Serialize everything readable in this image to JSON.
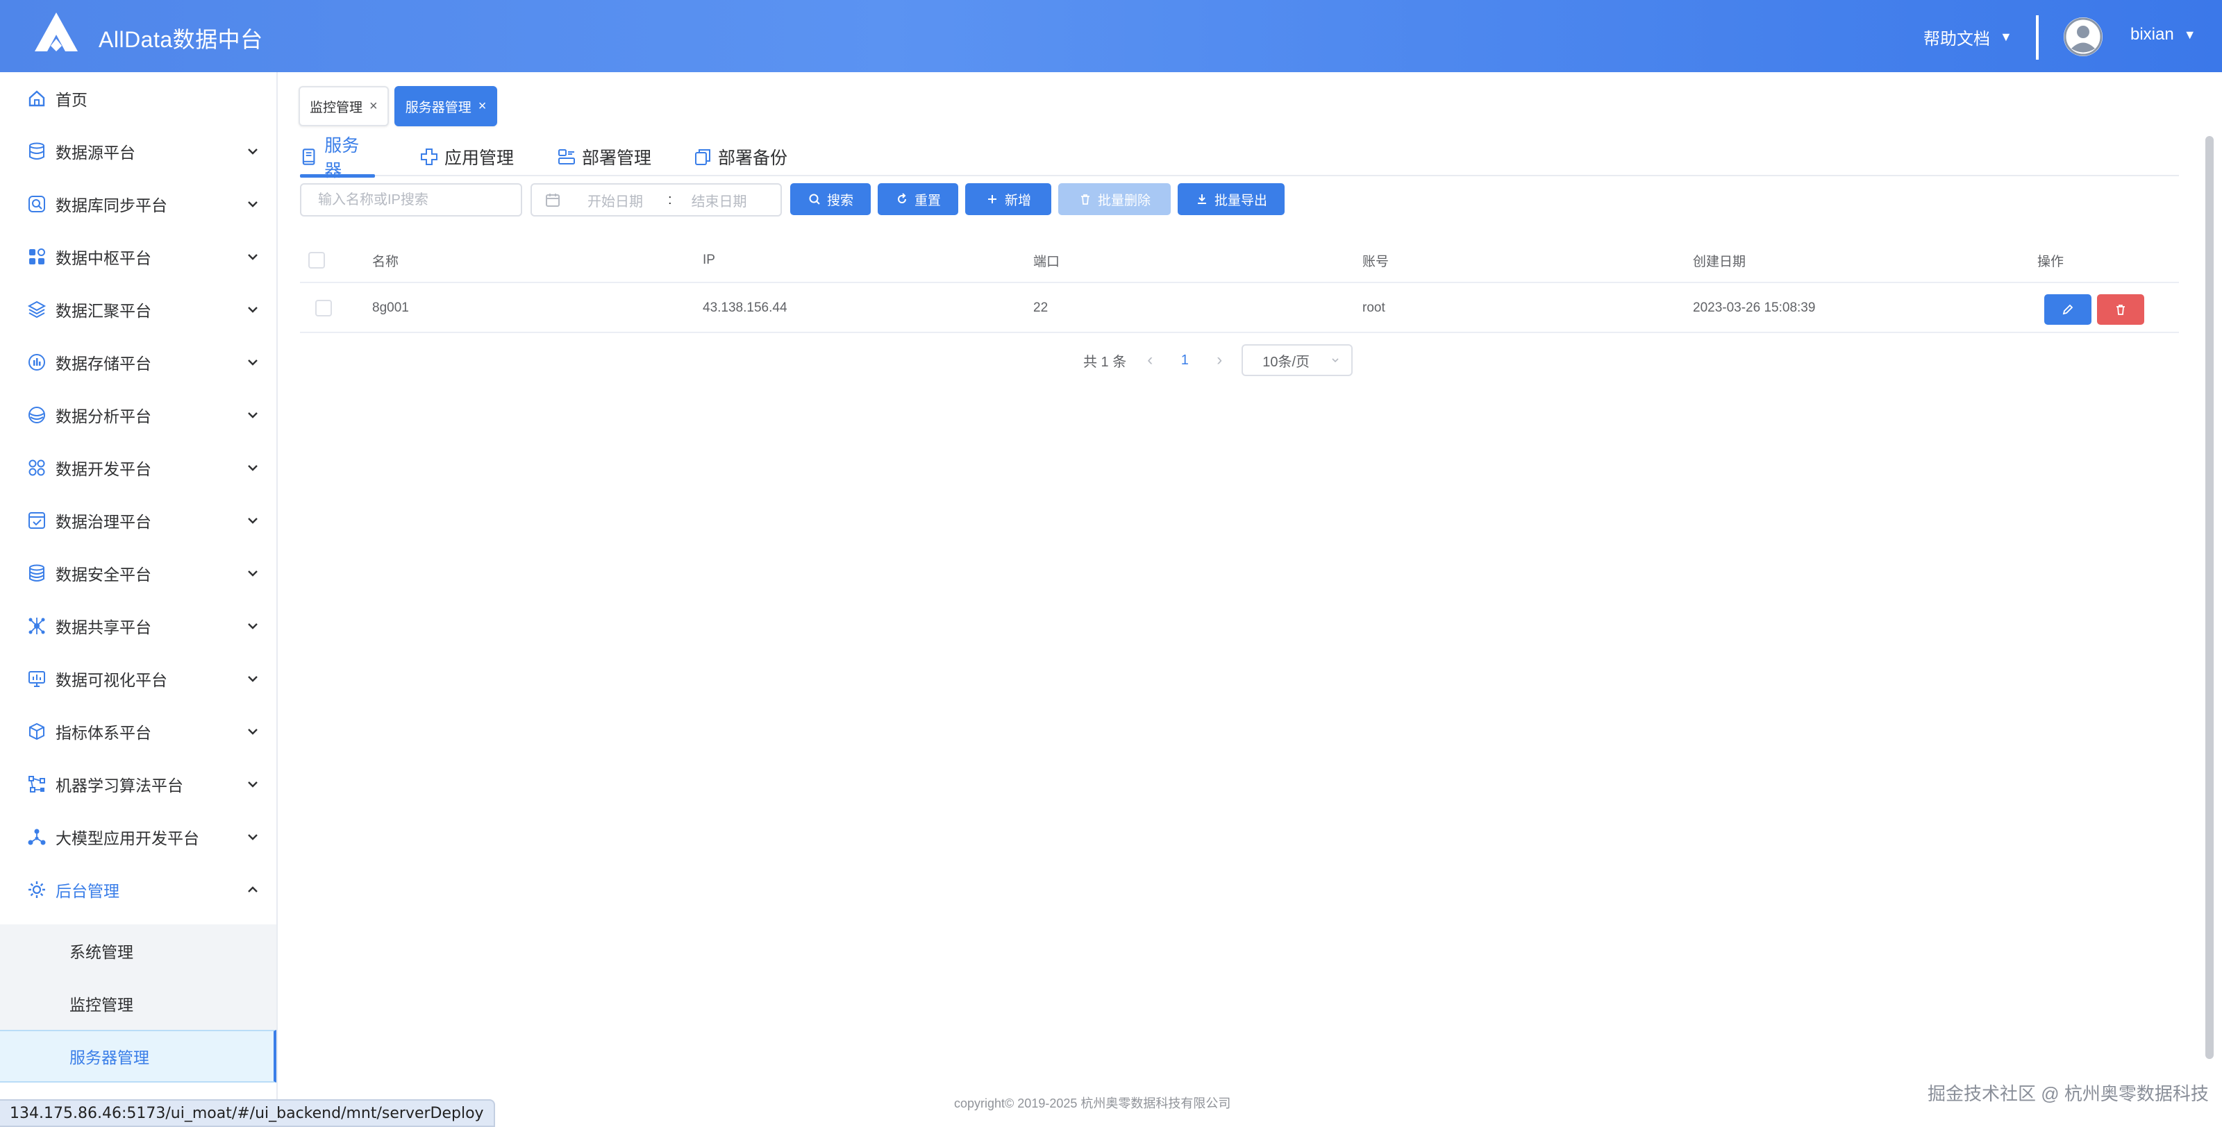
{
  "header": {
    "app_title": "AllData数据中台",
    "help_label": "帮助文档",
    "user_name": "bixian"
  },
  "sidebar": {
    "items": [
      {
        "label": "首页",
        "icon": "home-icon"
      },
      {
        "label": "数据源平台",
        "icon": "database-icon"
      },
      {
        "label": "数据库同步平台",
        "icon": "sync-icon"
      },
      {
        "label": "数据中枢平台",
        "icon": "grid-icon"
      },
      {
        "label": "数据汇聚平台",
        "icon": "layers-icon"
      },
      {
        "label": "数据存储平台",
        "icon": "storage-icon"
      },
      {
        "label": "数据分析平台",
        "icon": "analysis-icon"
      },
      {
        "label": "数据开发平台",
        "icon": "command-icon"
      },
      {
        "label": "数据治理平台",
        "icon": "checkbox-icon"
      },
      {
        "label": "数据安全平台",
        "icon": "security-icon"
      },
      {
        "label": "数据共享平台",
        "icon": "share-icon"
      },
      {
        "label": "数据可视化平台",
        "icon": "monitor-icon"
      },
      {
        "label": "指标体系平台",
        "icon": "cube-icon"
      },
      {
        "label": "机器学习算法平台",
        "icon": "algorithm-icon"
      },
      {
        "label": "大模型应用开发平台",
        "icon": "network-icon"
      },
      {
        "label": "后台管理",
        "icon": "settings-icon"
      }
    ],
    "sub_items": [
      {
        "label": "系统管理"
      },
      {
        "label": "监控管理"
      },
      {
        "label": "服务器管理"
      }
    ]
  },
  "status_url": "134.175.86.46:5173/ui_moat/#/ui_backend/mnt/serverDeploy",
  "tabs": [
    {
      "label": "监控管理",
      "active": false
    },
    {
      "label": "服务器管理",
      "active": true
    }
  ],
  "subtabs": [
    {
      "label": "服务器",
      "active": true
    },
    {
      "label": "应用管理",
      "active": false
    },
    {
      "label": "部署管理",
      "active": false
    },
    {
      "label": "部署备份",
      "active": false
    }
  ],
  "toolbar": {
    "search_placeholder": "输入名称或IP搜索",
    "start_date_placeholder": "开始日期",
    "date_separator": ":",
    "end_date_placeholder": "结束日期",
    "search_label": "搜索",
    "reset_label": "重置",
    "add_label": "新增",
    "batch_delete_label": "批量删除",
    "batch_export_label": "批量导出"
  },
  "table": {
    "columns": [
      "名称",
      "IP",
      "端口",
      "账号",
      "创建日期",
      "操作"
    ],
    "rows": [
      {
        "name": "8g001",
        "ip": "43.138.156.44",
        "port": "22",
        "account": "root",
        "created": "2023-03-26 15:08:39"
      }
    ]
  },
  "pagination": {
    "total_label": "共 1 条",
    "current_page": "1",
    "page_size": "10条/页"
  },
  "footer": "copyright© 2019-2025 杭州奥零数据科技有限公司",
  "watermark": "掘金技术社区 @ 杭州奥零数据科技",
  "colors": {
    "primary": "#3a7ee8",
    "danger": "#e85c5c",
    "header_bg": "#4f86ea"
  }
}
